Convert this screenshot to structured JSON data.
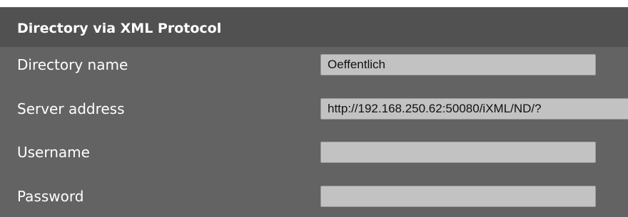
{
  "section": {
    "title": "Directory via XML Protocol"
  },
  "fields": {
    "directory_name": {
      "label": "Directory name",
      "value": "Oeffentlich"
    },
    "server_address": {
      "label": "Server address",
      "value": "http://192.168.250.62:50080/iXML/ND/?"
    },
    "username": {
      "label": "Username",
      "value": ""
    },
    "password": {
      "label": "Password",
      "value": ""
    }
  },
  "colors": {
    "panel_background": "#636363",
    "header_background": "#515151",
    "field_background": "#c2c2c2",
    "label_text": "#ffffff"
  }
}
